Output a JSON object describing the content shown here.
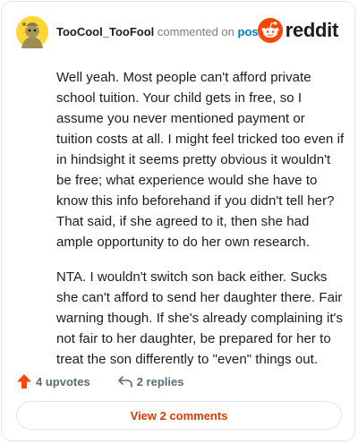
{
  "header": {
    "author": "TooCool_TooFool",
    "action_text": "commented on",
    "post_link": "post",
    "brand": "reddit"
  },
  "comment": {
    "paragraphs": [
      "Well yeah. Most people can't afford private school tuition. Your child gets in free, so I assume you never mentioned payment or tuition costs at all. I might feel tricked too even if in hindsight it seems pretty obvious it wouldn't be free; what experience would she have to know this info beforehand if you didn't tell her? That said, if she agreed to it, then she had ample opportunity to do her own research.",
      "NTA. I wouldn't switch son back either. Sucks she can't afford to send her daughter there. Fair warning though. If she's already complaining it's not fair to her daughter, be prepared for her to treat the son differently to \"even\" things out."
    ]
  },
  "actions": {
    "upvotes": "4 upvotes",
    "replies": "2 replies"
  },
  "footer": {
    "view_comments": "View 2 comments"
  },
  "colors": {
    "accent": "#ff4500",
    "link": "#0079d3",
    "button_text": "#d93a00"
  }
}
